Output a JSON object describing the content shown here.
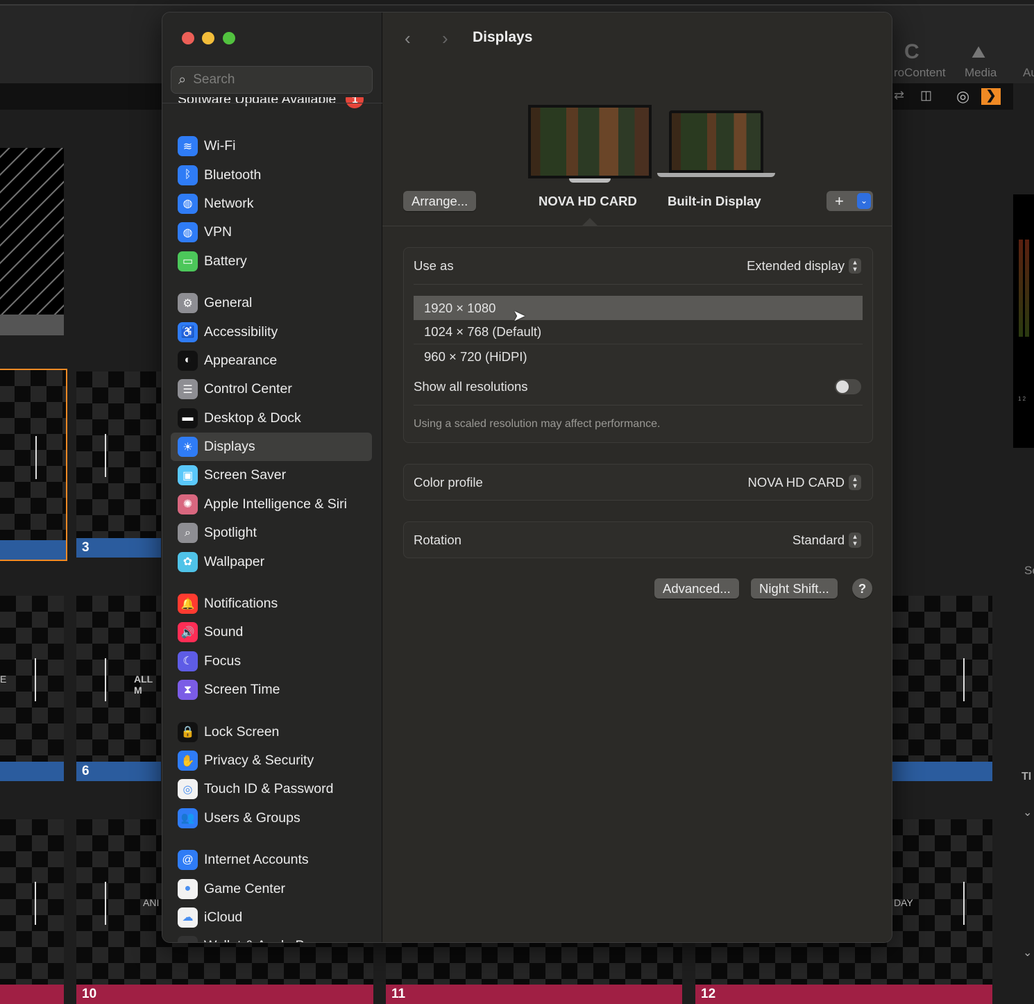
{
  "background_app": {
    "toolbar_labels": [
      "roContent",
      "Media",
      "Au"
    ],
    "tiles": [
      {
        "number": "3",
        "bar_color": "#2b5c9e"
      },
      {
        "number": "6",
        "bar_color": "#2b5c9e"
      },
      {
        "number": "10",
        "bar_color": "#a01f44"
      },
      {
        "number": "11",
        "bar_color": "#a01f44"
      },
      {
        "number": "12",
        "bar_color": "#a01f44"
      }
    ],
    "tile_texts": [
      "E",
      "ALL M",
      "ANI",
      "DAY"
    ],
    "right_labels": [
      "Se",
      "TI"
    ],
    "meter_labels": "1 2",
    "accent_orange": "#f08a24"
  },
  "window": {
    "search_placeholder": "Search",
    "software_update": {
      "label": "Software Update Available",
      "badge": "1"
    },
    "sidebar_groups": [
      [
        {
          "label": "Wi-Fi",
          "icon": "wifi-icon",
          "color": "#2f7cf6",
          "glyph": "≋"
        },
        {
          "label": "Bluetooth",
          "icon": "bluetooth-icon",
          "color": "#2f7cf6",
          "glyph": "ᛒ"
        },
        {
          "label": "Network",
          "icon": "globe-icon",
          "color": "#2f7cf6",
          "glyph": "◍"
        },
        {
          "label": "VPN",
          "icon": "vpn-globe-icon",
          "color": "#2f7cf6",
          "glyph": "◍"
        },
        {
          "label": "Battery",
          "icon": "battery-icon",
          "color": "#4cc75a",
          "glyph": "▭"
        }
      ],
      [
        {
          "label": "General",
          "icon": "gear-icon",
          "color": "#8e8e93",
          "glyph": "⚙"
        },
        {
          "label": "Accessibility",
          "icon": "accessibility-icon",
          "color": "#2f7cf6",
          "glyph": "♿"
        },
        {
          "label": "Appearance",
          "icon": "appearance-icon",
          "color": "#111111",
          "glyph": "◐"
        },
        {
          "label": "Control Center",
          "icon": "control-center-icon",
          "color": "#8e8e93",
          "glyph": "☰"
        },
        {
          "label": "Desktop & Dock",
          "icon": "dock-icon",
          "color": "#111111",
          "glyph": "▬"
        },
        {
          "label": "Displays",
          "icon": "brightness-icon",
          "color": "#2f7cf6",
          "glyph": "☀",
          "selected": true
        },
        {
          "label": "Screen Saver",
          "icon": "screen-saver-icon",
          "color": "#5ac8fa",
          "glyph": "▣"
        },
        {
          "label": "Apple Intelligence & Siri",
          "icon": "siri-icon",
          "color": "#d9677f",
          "glyph": "✺"
        },
        {
          "label": "Spotlight",
          "icon": "spotlight-icon",
          "color": "#8e8e93",
          "glyph": "⌕"
        },
        {
          "label": "Wallpaper",
          "icon": "wallpaper-icon",
          "color": "#4fc3e8",
          "glyph": "✿"
        }
      ],
      [
        {
          "label": "Notifications",
          "icon": "bell-icon",
          "color": "#ff3b30",
          "glyph": "🔔"
        },
        {
          "label": "Sound",
          "icon": "speaker-icon",
          "color": "#ff2d55",
          "glyph": "🔊"
        },
        {
          "label": "Focus",
          "icon": "moon-icon",
          "color": "#5e5ce6",
          "glyph": "☾"
        },
        {
          "label": "Screen Time",
          "icon": "hourglass-icon",
          "color": "#7b5ce6",
          "glyph": "⧗"
        }
      ],
      [
        {
          "label": "Lock Screen",
          "icon": "lock-icon",
          "color": "#111111",
          "glyph": "🔒"
        },
        {
          "label": "Privacy & Security",
          "icon": "hand-icon",
          "color": "#2f7cf6",
          "glyph": "✋"
        },
        {
          "label": "Touch ID & Password",
          "icon": "fingerprint-icon",
          "color": "#f2f2f2",
          "glyph": "◎"
        },
        {
          "label": "Users & Groups",
          "icon": "users-icon",
          "color": "#2f7cf6",
          "glyph": "👥"
        }
      ],
      [
        {
          "label": "Internet Accounts",
          "icon": "at-icon",
          "color": "#2f7cf6",
          "glyph": "@"
        },
        {
          "label": "Game Center",
          "icon": "game-center-icon",
          "color": "#f2f2f2",
          "glyph": "●"
        },
        {
          "label": "iCloud",
          "icon": "cloud-icon",
          "color": "#f2f2f2",
          "glyph": "☁"
        },
        {
          "label": "Wallet & Apple Pay",
          "icon": "wallet-icon",
          "color": "#333333",
          "glyph": "▤"
        }
      ]
    ],
    "main": {
      "title": "Displays",
      "arrange_label": "Arrange...",
      "displays": [
        {
          "name": "NOVA HD CARD",
          "selected": true
        },
        {
          "name": "Built-in Display"
        }
      ],
      "add_label": "+",
      "use_as": {
        "label": "Use as",
        "value": "Extended display"
      },
      "resolutions": [
        {
          "label": "1920 × 1080",
          "selected": true
        },
        {
          "label": "1024 × 768 (Default)"
        },
        {
          "label": "960 × 720 (HiDPI)"
        }
      ],
      "show_all": {
        "label": "Show all resolutions",
        "on": false
      },
      "note": "Using a scaled resolution may affect performance.",
      "color_profile": {
        "label": "Color profile",
        "value": "NOVA HD CARD"
      },
      "rotation": {
        "label": "Rotation",
        "value": "Standard"
      },
      "advanced_label": "Advanced...",
      "night_shift_label": "Night Shift...",
      "help_label": "?"
    }
  }
}
